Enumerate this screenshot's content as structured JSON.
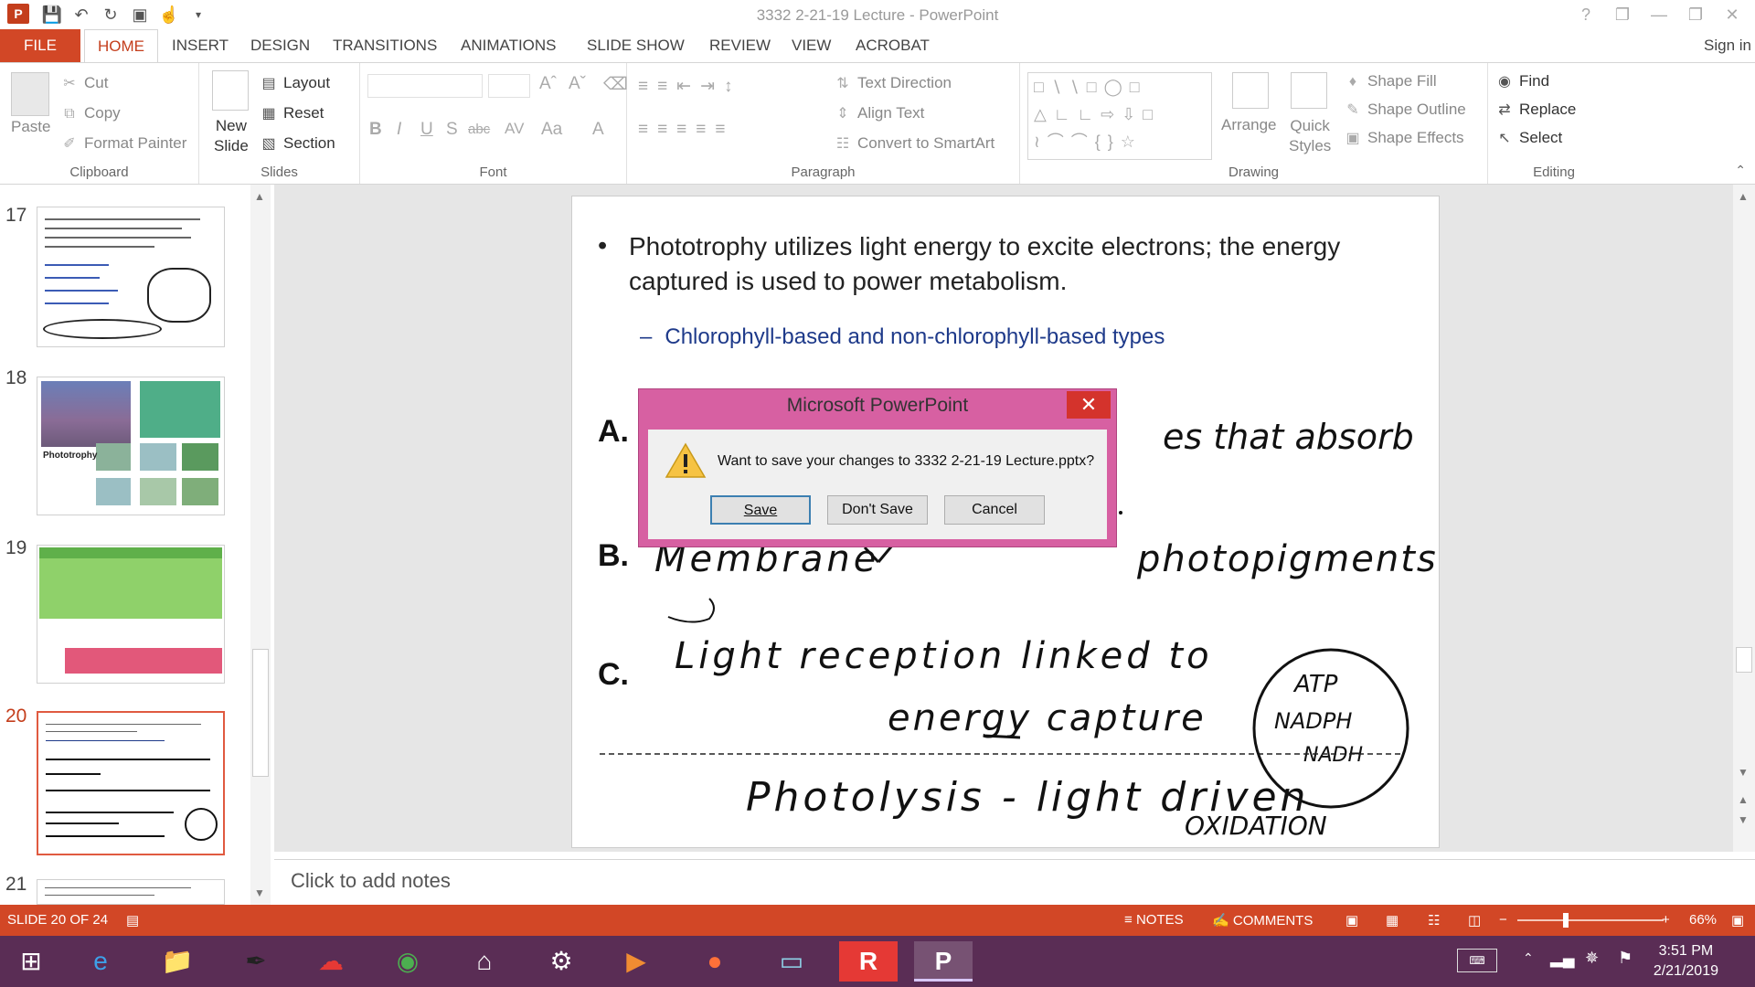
{
  "window": {
    "title": "3332 2-21-19 Lecture - PowerPoint",
    "app_logo": "P",
    "controls": [
      "?",
      "❐",
      "—",
      "❐",
      "✕"
    ]
  },
  "ribbon_tabs": {
    "file": "FILE",
    "tabs": [
      "HOME",
      "INSERT",
      "DESIGN",
      "TRANSITIONS",
      "ANIMATIONS",
      "SLIDE SHOW",
      "REVIEW",
      "VIEW",
      "ACROBAT"
    ],
    "active": "HOME",
    "sign_in": "Sign in"
  },
  "ribbon": {
    "clipboard": {
      "label": "Clipboard",
      "paste": "Paste",
      "cut": "Cut",
      "copy": "Copy",
      "format_painter": "Format Painter"
    },
    "slides": {
      "label": "Slides",
      "new_slide_line1": "New",
      "new_slide_line2": "Slide",
      "layout": "Layout",
      "reset": "Reset",
      "section": "Section"
    },
    "font": {
      "label": "Font",
      "format_buttons": [
        "B",
        "I",
        "U",
        "S",
        "abc",
        "AV",
        "Aa",
        "A"
      ]
    },
    "paragraph": {
      "label": "Paragraph",
      "text_direction": "Text Direction",
      "align_text": "Align Text",
      "convert_smartart": "Convert to SmartArt"
    },
    "drawing": {
      "label": "Drawing",
      "arrange": "Arrange",
      "quick_styles_line1": "Quick",
      "quick_styles_line2": "Styles",
      "shape_fill": "Shape Fill",
      "shape_outline": "Shape Outline",
      "shape_effects": "Shape Effects"
    },
    "editing": {
      "label": "Editing",
      "find": "Find",
      "replace": "Replace",
      "select": "Select"
    }
  },
  "thumbnails": [
    {
      "number": "17",
      "selected": false
    },
    {
      "number": "18",
      "selected": false,
      "caption": "Phototrophy"
    },
    {
      "number": "19",
      "selected": false
    },
    {
      "number": "20",
      "selected": true
    },
    {
      "number": "21",
      "selected": false
    }
  ],
  "slide": {
    "bullet": "•",
    "main_text": "Phototrophy utilizes light energy to excite electrons; the energy captured is used to power metabolism.",
    "dash": "–",
    "sub_text": "Chlorophyll-based and non-chlorophyll-based types",
    "letters": [
      "A.",
      "B.",
      "C."
    ],
    "ink": {
      "a_partial": "es that absorb",
      "b_left": "Membrane",
      "b_right": "photopigments",
      "c_line1": "Light reception linked to",
      "c_line2": "energy capture",
      "circle_1": "ATP",
      "circle_2": "NADPH",
      "circle_3": "NADH",
      "photolysis": "Photolysis - light driven",
      "oxidation": "OXIDATION"
    }
  },
  "notes": {
    "placeholder": "Click to add notes"
  },
  "status": {
    "slide_info": "SLIDE 20 OF 24",
    "notes_btn": "NOTES",
    "comments_btn": "COMMENTS",
    "zoom": "66%",
    "zoom_fraction": 0.33
  },
  "dialog": {
    "title": "Microsoft PowerPoint",
    "message": "Want to save your changes to 3332 2-21-19 Lecture.pptx?",
    "save": "Save",
    "dont_save": "Don't Save",
    "cancel": "Cancel",
    "close": "✕"
  },
  "taskbar": {
    "time": "3:51 PM",
    "date": "2/21/2019",
    "apps": [
      "windows-start",
      "internet-explorer",
      "file-explorer",
      "pen-tool",
      "cloud-app",
      "chrome",
      "home-app",
      "network-app",
      "media-player",
      "firefox",
      "notes-app",
      "r-app",
      "powerpoint"
    ]
  },
  "colors": {
    "accent": "#d24726",
    "dialog_frame": "#d760a2",
    "taskbar": "#5a2d55",
    "sub_bullet": "#1e3a8a"
  }
}
